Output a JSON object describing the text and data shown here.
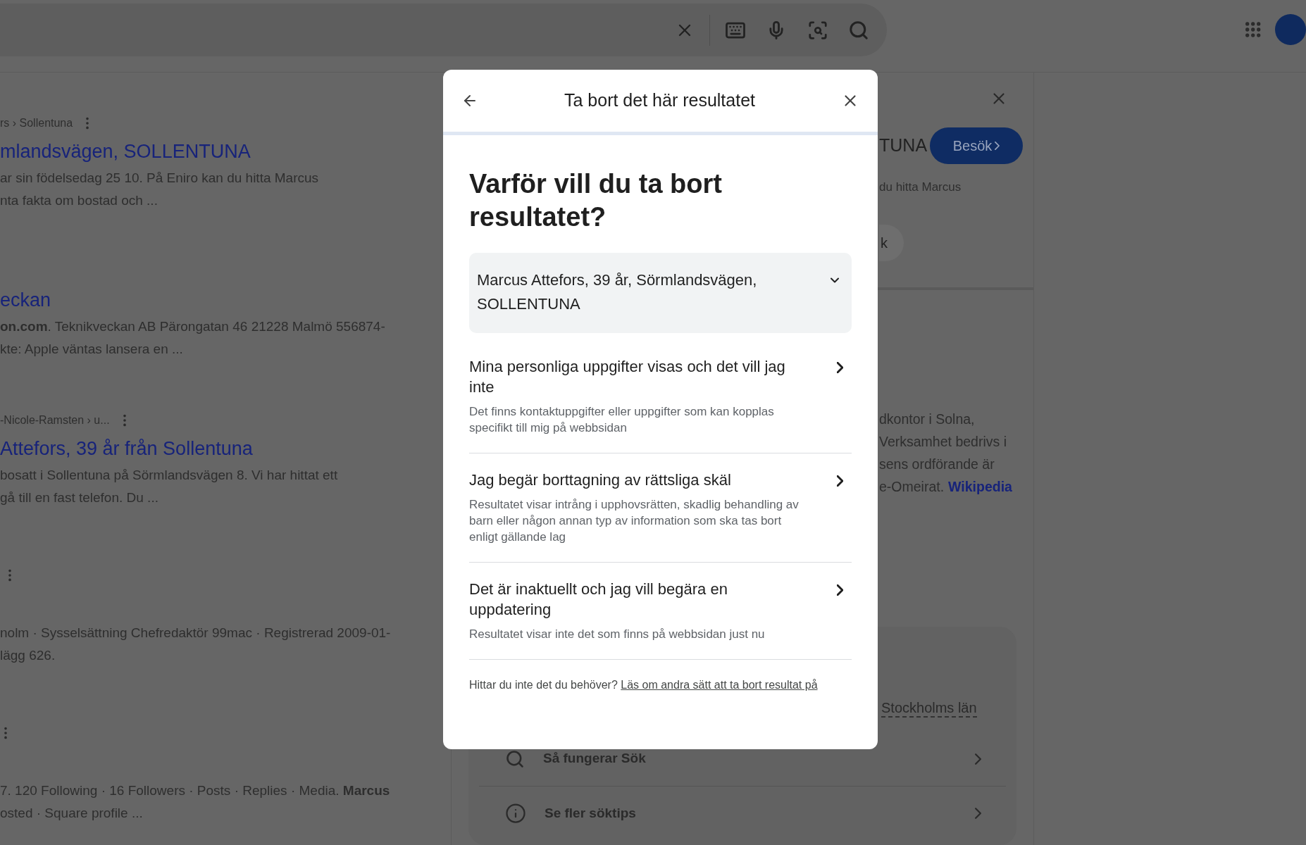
{
  "results": [
    {
      "breadcrumb": "rs › Sollentuna",
      "title": "mlandsvägen, SOLLENTUNA",
      "snippet": [
        "ar sin födelsedag 25 10. På Eniro kan du hitta Marcus",
        "nta fakta om bostad och ..."
      ]
    },
    {
      "title": "eckan",
      "snippet": [
        "**on.com**. Teknikveckan AB Pärongatan 46 21228 Malmö 556874-",
        "kte: Apple väntas lansera en ..."
      ]
    },
    {
      "breadcrumb": "-Nicole-Ramsten › u...",
      "title": "Attefors, 39 år från Sollentuna",
      "snippet": [
        "bosatt i Sollentuna på Sörmlandsvägen 8. Vi har hittat ett",
        "gå till en fast telefon. Du ..."
      ]
    },
    {
      "snippet": [
        "nolm · Sysselsättning Chefredaktör 99mac · Registrerad 2009-01-",
        "lägg 626."
      ]
    },
    {
      "snippet": [
        "7. 120 Following · 16 Followers · Posts · Replies · Media. **Marcus**",
        "osted · Square profile ..."
      ]
    }
  ],
  "knowledge_panel": {
    "title": "TUNA",
    "button": "Besök",
    "snippet": "du hitta Marcus",
    "chip": "k",
    "description": [
      "dkontor i Solna,",
      "Verksamhet bedrivs i",
      "sens ordförande är",
      "e-Omeirat."
    ],
    "source_link": "Wikipedia",
    "location": "Stockholms län",
    "links": [
      {
        "kind": "search",
        "label": "Så fungerar Sök"
      },
      {
        "kind": "info",
        "label": "Se fler söktips"
      }
    ]
  },
  "dialog": {
    "title": "Ta bort det här resultatet",
    "heading": "Varför vill du ta bort resultatet?",
    "selected_result": "Marcus Attefors, 39 år, Sörmlandsvägen, SOLLENTUNA",
    "options": [
      {
        "title": "Mina personliga uppgifter visas och det vill jag inte",
        "description": "Det finns kontaktuppgifter eller uppgifter som kan kopplas specifikt till mig på webbsidan"
      },
      {
        "title": "Jag begär borttagning av rättsliga skäl",
        "description": "Resultatet visar intrång i upphovsrätten, skadlig behandling av barn eller någon annan typ av information som ska tas bort enligt gällande lag"
      },
      {
        "title": "Det är inaktuellt och jag vill begära en uppdatering",
        "description": "Resultatet visar inte det som finns på webbsidan just nu"
      }
    ],
    "footer_text": "Hittar du inte det du behöver?",
    "footer_link": "Läs om andra sätt att ta bort resultat på"
  }
}
